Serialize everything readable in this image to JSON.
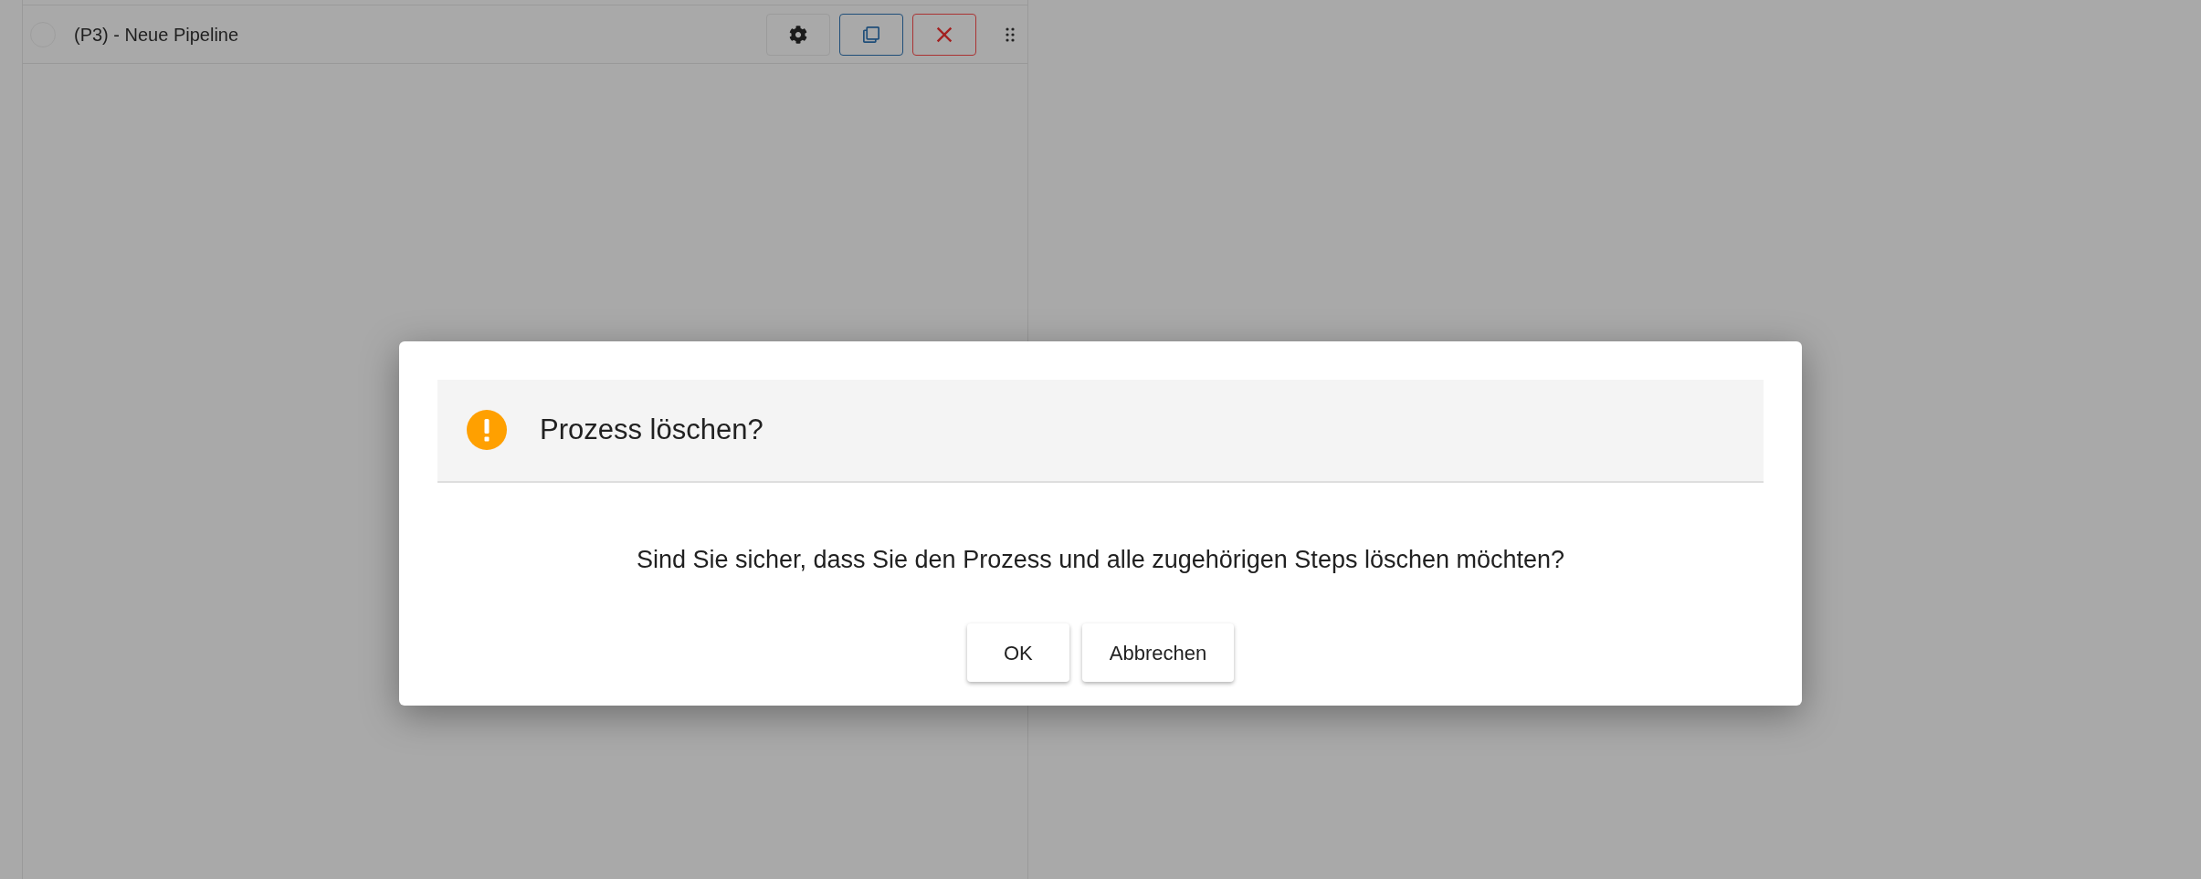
{
  "pipeline_row": {
    "selected": false,
    "label": "(P3) - Neue Pipeline"
  },
  "dialog": {
    "title": "Prozess löschen?",
    "message": "Sind Sie sicher, dass Sie den Prozess und alle zugehörigen Steps löschen möchten?",
    "buttons": [
      "OK",
      "Abbrechen"
    ]
  }
}
